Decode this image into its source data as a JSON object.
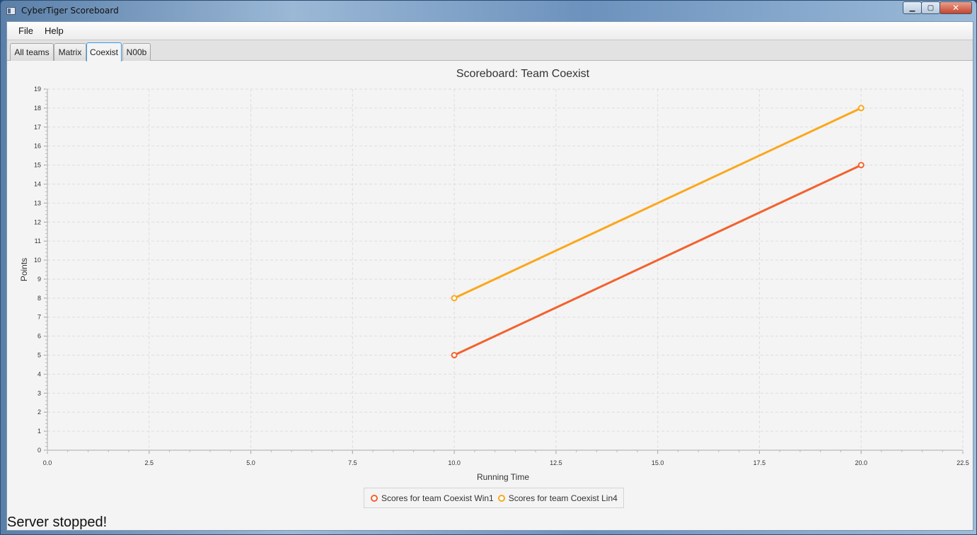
{
  "window": {
    "title": "CyberTiger Scoreboard",
    "min_icon": "minimize-icon",
    "max_icon": "maximize-icon",
    "close_icon": "close-icon"
  },
  "menu": {
    "items": [
      "File",
      "Help"
    ]
  },
  "tabs": [
    {
      "label": "All teams",
      "active": false
    },
    {
      "label": "Matrix",
      "active": false
    },
    {
      "label": "Coexist",
      "active": true
    },
    {
      "label": "N00b",
      "active": false
    }
  ],
  "colors": {
    "series1": "#f3622d",
    "series2": "#fba71b",
    "grid": "#dddddd",
    "plot_bg": "#f4f4f4"
  },
  "chart_data": {
    "type": "line",
    "title": "Scoreboard: Team Coexist",
    "xlabel": "Running Time",
    "ylabel": "Points",
    "xlim": [
      0,
      22.5
    ],
    "ylim": [
      0,
      19
    ],
    "xticks": [
      "0.0",
      "2.5",
      "5.0",
      "7.5",
      "10.0",
      "12.5",
      "15.0",
      "17.5",
      "20.0",
      "22.5"
    ],
    "yticks": [
      "0",
      "1",
      "2",
      "3",
      "4",
      "5",
      "6",
      "7",
      "8",
      "9",
      "10",
      "11",
      "12",
      "13",
      "14",
      "15",
      "16",
      "17",
      "18",
      "19"
    ],
    "grid": true,
    "legend_position": "bottom",
    "series": [
      {
        "name": "Scores for team Coexist Win1",
        "x": [
          10,
          20
        ],
        "y": [
          5,
          15
        ],
        "color": "#f3622d"
      },
      {
        "name": "Scores for team Coexist Lin4",
        "x": [
          10,
          20
        ],
        "y": [
          8,
          18
        ],
        "color": "#fba71b"
      }
    ]
  },
  "status": {
    "text": "Server stopped!"
  }
}
